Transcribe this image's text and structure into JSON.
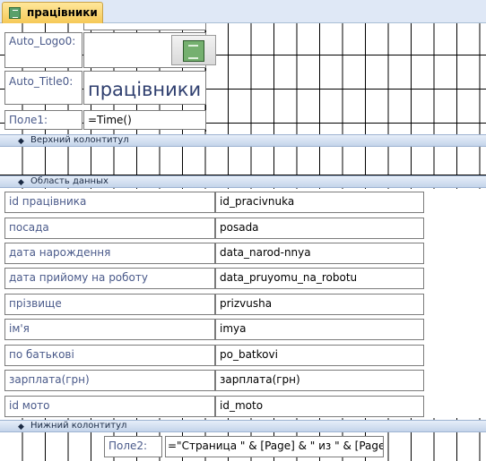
{
  "tab": {
    "label": "працівники",
    "icon": "report-icon"
  },
  "report_header": {
    "logo_label": "Auto_Logo0:",
    "logo_icon": "report-icon",
    "title_label": "Auto_Title0:",
    "title_value": "працівники",
    "field1_label": "Поле1:",
    "field1_value": "=Time()"
  },
  "bands": {
    "page_header": "Верхний колонтитул",
    "detail": "Область данных",
    "page_footer": "Нижний колонтитул"
  },
  "detail_rows": [
    {
      "label": "id працівника",
      "value": "id_pracivnuka"
    },
    {
      "label": "посада",
      "value": "posada"
    },
    {
      "label": "дата нарождення",
      "value": "data_narod-nnya"
    },
    {
      "label": "дата прийому на роботу",
      "value": "data_pruyomu_na_robotu"
    },
    {
      "label": "прізвище",
      "value": "prizvusha"
    },
    {
      "label": "ім'я",
      "value": "imya"
    },
    {
      "label": "по батькові",
      "value": "po_batkovi"
    },
    {
      "label": "зарплата(грн)",
      "value": "зарплата(грн)"
    },
    {
      "label": "id мото",
      "value": "id_moto"
    }
  ],
  "page_footer": {
    "field2_label": "Поле2:",
    "field2_value": "=\"Страница \" & [Page] & \" из \" & [Page"
  },
  "colors": {
    "band": "#c4d4ea",
    "label_text": "#4a5a8a",
    "tab": "#f6c957"
  }
}
